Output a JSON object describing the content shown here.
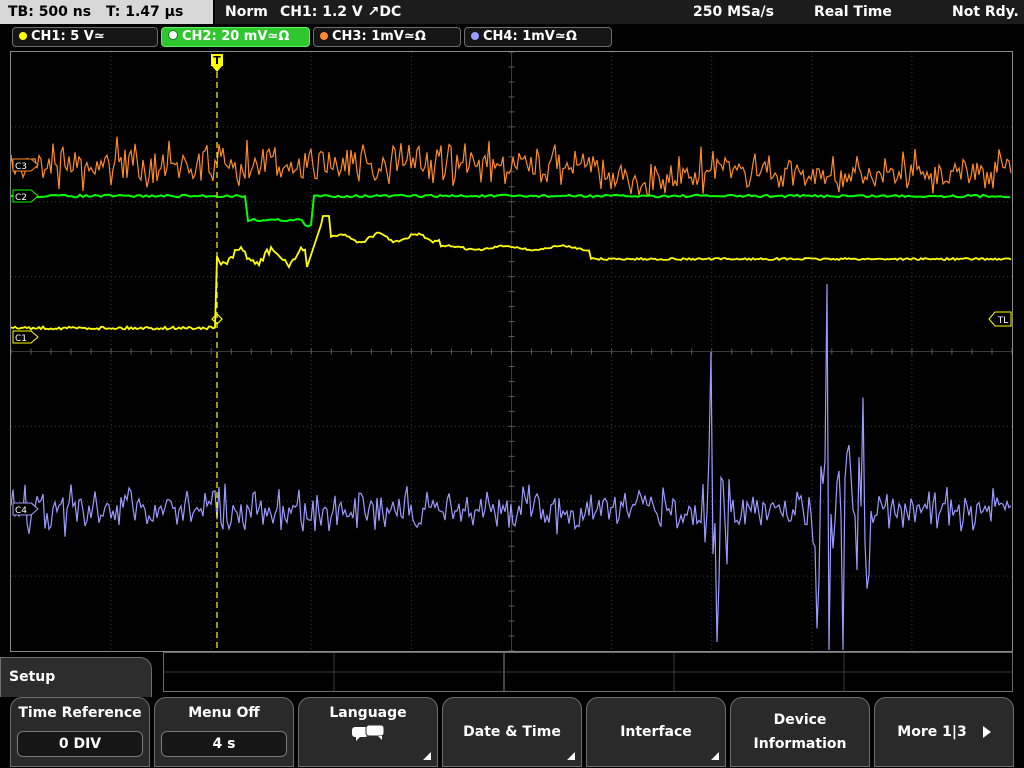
{
  "status": {
    "tb": "TB: 500 ns",
    "t": "T: 1.47 µs",
    "mode": "Norm",
    "trigger": "CH1: 1.2 V ↗DC",
    "sample_rate": "250 MSa/s",
    "acq": "Real Time",
    "ready": "Not Rdy."
  },
  "channels": [
    {
      "label": "CH1: 5 V≃",
      "color": "#ffff00",
      "active": false
    },
    {
      "label": "CH2: 20 mV≃Ω",
      "color": "#00ff00",
      "active": true
    },
    {
      "label": "CH3: 1mV≃Ω",
      "color": "#ff8a2a",
      "active": false
    },
    {
      "label": "CH4: 1mV≃Ω",
      "color": "#9b9bff",
      "active": false
    }
  ],
  "markers": {
    "c3": "C3",
    "c2": "C2",
    "c1": "C1",
    "c4": "C4",
    "tl": "TL",
    "trig": "T"
  },
  "menu": {
    "title": "Setup",
    "time_reference": {
      "label": "Time Reference",
      "value": "0 DIV"
    },
    "menu_off": {
      "label": "Menu Off",
      "value": "4 s"
    },
    "language": {
      "label": "Language"
    },
    "date_time": {
      "label": "Date & Time"
    },
    "interface": {
      "label": "Interface"
    },
    "device_info": {
      "line1": "Device",
      "line2": "Information"
    },
    "more": {
      "label": "More 1|3"
    }
  },
  "colors": {
    "ch1": "#ffff00",
    "ch2": "#00ff00",
    "ch3": "#ff8a2a",
    "ch4": "#9b9bff",
    "grid": "#3a3a3a"
  }
}
